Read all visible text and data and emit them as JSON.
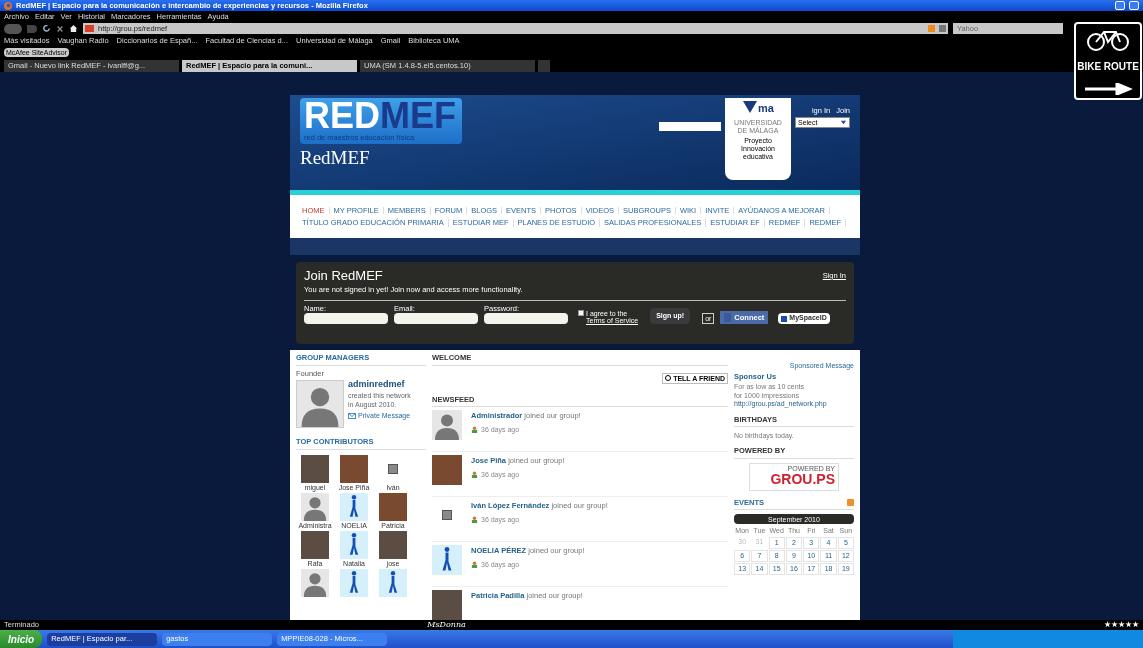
{
  "browser": {
    "title": "RedMEF | Espacio para la comunicación e intercambio de experiencias y recursos - Mozilla Firefox",
    "menu": [
      "Archivo",
      "Editar",
      "Ver",
      "Historial",
      "Marcadores",
      "Herramientas",
      "Ayuda"
    ],
    "url": "http://grou.ps/redmef",
    "search_placeholder": "Yahoo",
    "bookmarks": [
      "Más visitados",
      "Vaughan Radio",
      "Diccionarios de Españ...",
      "Facultad de Ciencias d...",
      "Universidad de Málaga",
      "Gmail",
      "Biblioteca UMA"
    ],
    "addon": "McAfee SiteAdvisor",
    "tabs": [
      {
        "label": "Gmail - Nuevo link RedMEF - ivanlff@g...",
        "selected": false
      },
      {
        "label": "RedMEF | Espacio para la comuni...",
        "selected": true
      },
      {
        "label": "UMA (SM 1.4.8-5.el5.centos.10)",
        "selected": false
      }
    ],
    "status": "Terminado",
    "status_center": "MsDonna",
    "rating": "★★★★★"
  },
  "sign": {
    "text": "BIKE ROUTE"
  },
  "site": {
    "logo_a": "RED",
    "logo_b": "MEF",
    "tagline": "red de maestros educación física",
    "name": "RedMEF",
    "uma": {
      "mark": "ma",
      "line1": "UNIVERSIDAD",
      "line2": "DE MÁLAGA",
      "caption": "Proyecto Innovación educativa"
    },
    "header_links": [
      "ign In",
      "Join"
    ],
    "select": "Select",
    "menu_rows": [
      [
        {
          "label": "HOME",
          "selected": true
        },
        {
          "label": "MY PROFILE",
          "selected": false
        },
        {
          "label": "MEMBERS",
          "selected": false
        },
        {
          "label": "FORUM",
          "selected": false
        },
        {
          "label": "BLOGS",
          "selected": false
        },
        {
          "label": "EVENTS",
          "selected": false
        },
        {
          "label": "PHOTOS",
          "selected": false
        },
        {
          "label": "VIDEOS",
          "selected": false
        },
        {
          "label": "SUBGROUPS",
          "selected": false
        },
        {
          "label": "WIKI",
          "selected": false
        },
        {
          "label": "INVITE",
          "selected": false
        },
        {
          "label": "AYÚDANOS A MEJORAR",
          "selected": false
        }
      ],
      [
        {
          "label": "TÍTULO GRADO EDUCACIÓN PRIMARIA",
          "selected": false
        },
        {
          "label": "ESTUDIAR MEF",
          "selected": false
        },
        {
          "label": "PLANES DE ESTUDIO",
          "selected": false
        },
        {
          "label": "SALIDAS PROFESIONALES",
          "selected": false
        },
        {
          "label": "ESTUDIAR EF",
          "selected": false
        },
        {
          "label": "REDMEF",
          "selected": false
        },
        {
          "label": "REDMEF",
          "selected": false
        }
      ]
    ]
  },
  "join": {
    "title": "Join RedMEF",
    "subtitle": "You are not signed in yet! Join now and access more functionality.",
    "sign_in": "Sign In",
    "fields": [
      "Name:",
      "Email:",
      "Password:"
    ],
    "terms": {
      "checked": false,
      "text": "I agree to the",
      "link": "Terms of Service"
    },
    "signup": "Sign up!",
    "or": "or",
    "connect": "Connect",
    "myspace": "MySpaceID"
  },
  "managers": {
    "title": "GROUP MANAGERS",
    "role": "Founder",
    "name": "adminredmef",
    "line1": "created this network",
    "line2": "in August 2010.",
    "message": "Private Message"
  },
  "contributors": {
    "title": "TOP CONTRIBUTORS",
    "items": [
      {
        "name": "miguel",
        "kind": "photo"
      },
      {
        "name": "Jose Piña",
        "kind": "photo"
      },
      {
        "name": "Iván",
        "kind": "small-photo"
      },
      {
        "name": "Administra",
        "kind": "silhouette"
      },
      {
        "name": "NOELIA",
        "kind": "runner"
      },
      {
        "name": "Patricia",
        "kind": "photo"
      },
      {
        "name": "Rafa",
        "kind": "photo"
      },
      {
        "name": "Natalia",
        "kind": "runner"
      },
      {
        "name": "jose",
        "kind": "photo"
      },
      {
        "kind": "silhouette"
      },
      {
        "kind": "runner"
      },
      {
        "kind": "runner"
      }
    ]
  },
  "welcome": {
    "title": "WELCOME",
    "tell": "TELL A FRIEND"
  },
  "newsfeed": {
    "title": "NEWSFEED",
    "items": [
      {
        "name": "Administrador",
        "text": "joined our group!",
        "time": "36 days ago",
        "kind": "silhouette"
      },
      {
        "name": "Jose Piña",
        "text": "joined our group!",
        "time": "36 days ago",
        "kind": "photo"
      },
      {
        "name": "Iván López Fernández",
        "text": "joined our group!",
        "time": "36 days ago",
        "kind": "small-photo"
      },
      {
        "name": "NOELIA PÉREZ",
        "text": "joined our group!",
        "time": "36 days ago",
        "kind": "runner"
      },
      {
        "name": "Patricia Padilla",
        "text": "joined our group!",
        "kind": "photo"
      }
    ]
  },
  "sponsor": {
    "label": "Sponsored Message",
    "title": "Sponsor Us",
    "line1": "For as low as 10 cents",
    "line2": "for 1000 impressions",
    "link": "http://grou.ps/ad_network.php"
  },
  "birthdays": {
    "title": "BIRTHDAYS",
    "text": "No birthdays today."
  },
  "powered": {
    "title": "POWERED BY",
    "small": "POWERED BY",
    "logo": "GROU.PS"
  },
  "events": {
    "title": "EVENTS",
    "month": "September 2010",
    "weekdays": [
      "Mon",
      "Tue",
      "Wed",
      "Thu",
      "Fri",
      "Sat",
      "Sun"
    ],
    "days": [
      {
        "d": "30",
        "muted": true
      },
      {
        "d": "31",
        "muted": true
      },
      {
        "d": "1",
        "muted": false
      },
      {
        "d": "2",
        "muted": false
      },
      {
        "d": "3",
        "muted": false
      },
      {
        "d": "4",
        "muted": false
      },
      {
        "d": "5",
        "muted": false
      },
      {
        "d": "6",
        "muted": false
      },
      {
        "d": "7",
        "muted": false
      },
      {
        "d": "8",
        "muted": false
      },
      {
        "d": "9",
        "muted": false
      },
      {
        "d": "10",
        "muted": false
      },
      {
        "d": "11",
        "muted": false
      },
      {
        "d": "12",
        "muted": false
      },
      {
        "d": "13",
        "muted": false
      },
      {
        "d": "14",
        "muted": false
      },
      {
        "d": "15",
        "muted": false
      },
      {
        "d": "16",
        "muted": false
      },
      {
        "d": "17",
        "muted": false
      },
      {
        "d": "18",
        "muted": false
      },
      {
        "d": "19",
        "muted": false
      }
    ]
  },
  "taskbar": {
    "start": "Inicio",
    "items": [
      {
        "label": "RedMEF | Espacio par...",
        "selected": true
      },
      {
        "label": "gastos",
        "selected": false
      },
      {
        "label": "MPPIE08-028 - Micros...",
        "selected": false
      }
    ]
  }
}
